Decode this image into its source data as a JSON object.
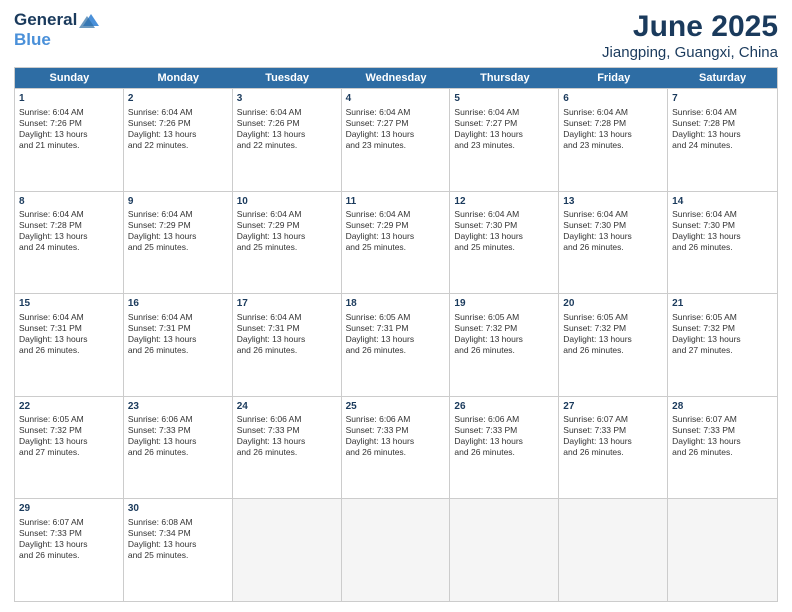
{
  "logo": {
    "part1": "General",
    "part2": "Blue"
  },
  "title": "June 2025",
  "subtitle": "Jiangping, Guangxi, China",
  "days_header": [
    "Sunday",
    "Monday",
    "Tuesday",
    "Wednesday",
    "Thursday",
    "Friday",
    "Saturday"
  ],
  "rows": [
    [
      {
        "day": "1",
        "info": "Sunrise: 6:04 AM\nSunset: 7:26 PM\nDaylight: 13 hours\nand 21 minutes."
      },
      {
        "day": "2",
        "info": "Sunrise: 6:04 AM\nSunset: 7:26 PM\nDaylight: 13 hours\nand 22 minutes."
      },
      {
        "day": "3",
        "info": "Sunrise: 6:04 AM\nSunset: 7:26 PM\nDaylight: 13 hours\nand 22 minutes."
      },
      {
        "day": "4",
        "info": "Sunrise: 6:04 AM\nSunset: 7:27 PM\nDaylight: 13 hours\nand 23 minutes."
      },
      {
        "day": "5",
        "info": "Sunrise: 6:04 AM\nSunset: 7:27 PM\nDaylight: 13 hours\nand 23 minutes."
      },
      {
        "day": "6",
        "info": "Sunrise: 6:04 AM\nSunset: 7:28 PM\nDaylight: 13 hours\nand 23 minutes."
      },
      {
        "day": "7",
        "info": "Sunrise: 6:04 AM\nSunset: 7:28 PM\nDaylight: 13 hours\nand 24 minutes."
      }
    ],
    [
      {
        "day": "8",
        "info": "Sunrise: 6:04 AM\nSunset: 7:28 PM\nDaylight: 13 hours\nand 24 minutes."
      },
      {
        "day": "9",
        "info": "Sunrise: 6:04 AM\nSunset: 7:29 PM\nDaylight: 13 hours\nand 25 minutes."
      },
      {
        "day": "10",
        "info": "Sunrise: 6:04 AM\nSunset: 7:29 PM\nDaylight: 13 hours\nand 25 minutes."
      },
      {
        "day": "11",
        "info": "Sunrise: 6:04 AM\nSunset: 7:29 PM\nDaylight: 13 hours\nand 25 minutes."
      },
      {
        "day": "12",
        "info": "Sunrise: 6:04 AM\nSunset: 7:30 PM\nDaylight: 13 hours\nand 25 minutes."
      },
      {
        "day": "13",
        "info": "Sunrise: 6:04 AM\nSunset: 7:30 PM\nDaylight: 13 hours\nand 26 minutes."
      },
      {
        "day": "14",
        "info": "Sunrise: 6:04 AM\nSunset: 7:30 PM\nDaylight: 13 hours\nand 26 minutes."
      }
    ],
    [
      {
        "day": "15",
        "info": "Sunrise: 6:04 AM\nSunset: 7:31 PM\nDaylight: 13 hours\nand 26 minutes."
      },
      {
        "day": "16",
        "info": "Sunrise: 6:04 AM\nSunset: 7:31 PM\nDaylight: 13 hours\nand 26 minutes."
      },
      {
        "day": "17",
        "info": "Sunrise: 6:04 AM\nSunset: 7:31 PM\nDaylight: 13 hours\nand 26 minutes."
      },
      {
        "day": "18",
        "info": "Sunrise: 6:05 AM\nSunset: 7:31 PM\nDaylight: 13 hours\nand 26 minutes."
      },
      {
        "day": "19",
        "info": "Sunrise: 6:05 AM\nSunset: 7:32 PM\nDaylight: 13 hours\nand 26 minutes."
      },
      {
        "day": "20",
        "info": "Sunrise: 6:05 AM\nSunset: 7:32 PM\nDaylight: 13 hours\nand 26 minutes."
      },
      {
        "day": "21",
        "info": "Sunrise: 6:05 AM\nSunset: 7:32 PM\nDaylight: 13 hours\nand 27 minutes."
      }
    ],
    [
      {
        "day": "22",
        "info": "Sunrise: 6:05 AM\nSunset: 7:32 PM\nDaylight: 13 hours\nand 27 minutes."
      },
      {
        "day": "23",
        "info": "Sunrise: 6:06 AM\nSunset: 7:33 PM\nDaylight: 13 hours\nand 26 minutes."
      },
      {
        "day": "24",
        "info": "Sunrise: 6:06 AM\nSunset: 7:33 PM\nDaylight: 13 hours\nand 26 minutes."
      },
      {
        "day": "25",
        "info": "Sunrise: 6:06 AM\nSunset: 7:33 PM\nDaylight: 13 hours\nand 26 minutes."
      },
      {
        "day": "26",
        "info": "Sunrise: 6:06 AM\nSunset: 7:33 PM\nDaylight: 13 hours\nand 26 minutes."
      },
      {
        "day": "27",
        "info": "Sunrise: 6:07 AM\nSunset: 7:33 PM\nDaylight: 13 hours\nand 26 minutes."
      },
      {
        "day": "28",
        "info": "Sunrise: 6:07 AM\nSunset: 7:33 PM\nDaylight: 13 hours\nand 26 minutes."
      }
    ],
    [
      {
        "day": "29",
        "info": "Sunrise: 6:07 AM\nSunset: 7:33 PM\nDaylight: 13 hours\nand 26 minutes."
      },
      {
        "day": "30",
        "info": "Sunrise: 6:08 AM\nSunset: 7:34 PM\nDaylight: 13 hours\nand 25 minutes."
      },
      {
        "day": "",
        "info": ""
      },
      {
        "day": "",
        "info": ""
      },
      {
        "day": "",
        "info": ""
      },
      {
        "day": "",
        "info": ""
      },
      {
        "day": "",
        "info": ""
      }
    ]
  ]
}
